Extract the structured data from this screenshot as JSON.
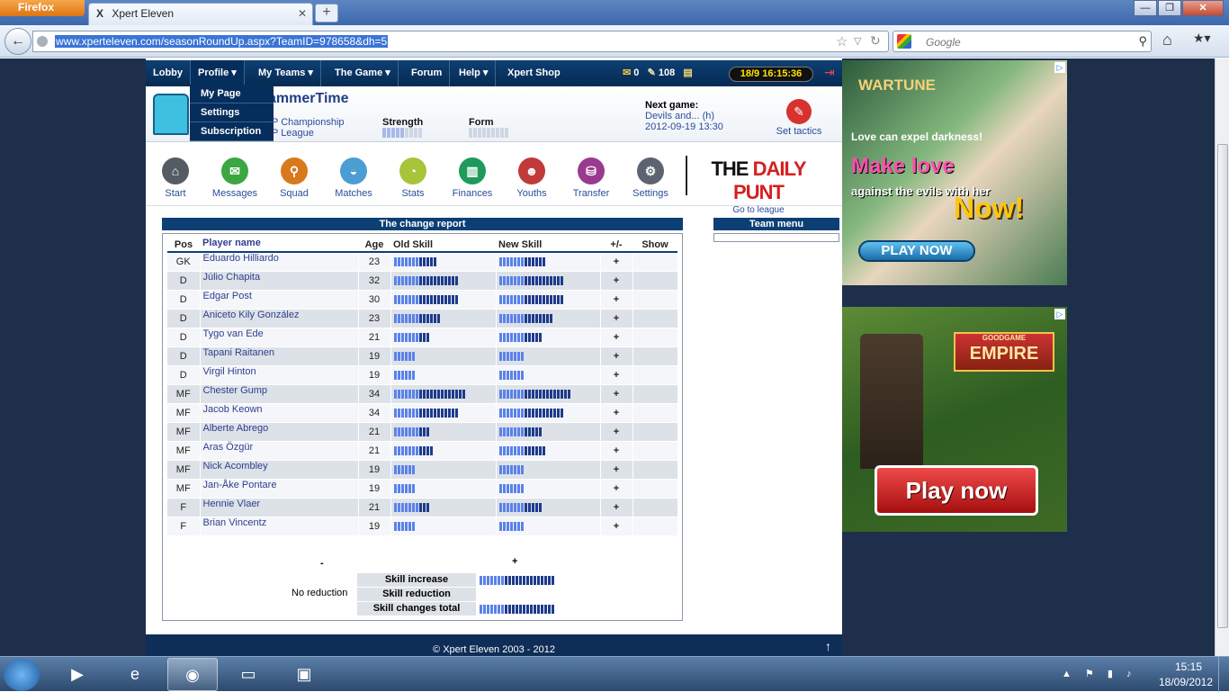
{
  "browser": {
    "menu_button": "Firefox",
    "tab_title": "Xpert Eleven",
    "tab_favicon": "X",
    "url": "www.xperteleven.com/seasonRoundUp.aspx?TeamID=978658&dh=5",
    "search_placeholder": "Google",
    "window_buttons": {
      "minimize": "—",
      "maximize": "❐",
      "close": "✕"
    }
  },
  "site_nav": {
    "items": [
      "Lobby",
      "Profile ▾",
      "My Teams ▾",
      "The Game ▾",
      "Forum",
      "Help ▾",
      "Xpert Shop"
    ],
    "messages_count": "0",
    "credits": "108",
    "clock": "18/9 16:15:36"
  },
  "profile_dropdown": [
    "My Page",
    "Settings",
    "Subscription"
  ],
  "team": {
    "name": "HammerTime",
    "name_visible": "ammerTime",
    "league_1": "P Championship",
    "league_2": "P League",
    "strength_label": "Strength",
    "form_label": "Form",
    "strength_value": 0.55,
    "next_game_label": "Next game:",
    "next_game_opponent": "Devils and... (h)",
    "next_game_time": "2012-09-19 13:30",
    "set_tactics": "Set tactics"
  },
  "icon_menu": [
    {
      "label": "Start",
      "icon": "home-icon",
      "color": "#555b63",
      "glyph": "⌂"
    },
    {
      "label": "Messages",
      "icon": "envelope-icon",
      "color": "#3aa743",
      "glyph": "✉"
    },
    {
      "label": "Squad",
      "icon": "runner-icon",
      "color": "#d8791d",
      "glyph": "⚲"
    },
    {
      "label": "Matches",
      "icon": "pitch-icon",
      "color": "#4b9dd4",
      "glyph": "◒"
    },
    {
      "label": "Stats",
      "icon": "pie-chart-icon",
      "color": "#a7c43a",
      "glyph": "◔"
    },
    {
      "label": "Finances",
      "icon": "bar-chart-icon",
      "color": "#1f9a5a",
      "glyph": "▥"
    },
    {
      "label": "Youths",
      "icon": "people-icon",
      "color": "#c03a3a",
      "glyph": "☻"
    },
    {
      "label": "Transfer",
      "icon": "basket-icon",
      "color": "#9a3a8e",
      "glyph": "⛁"
    },
    {
      "label": "Settings",
      "icon": "gear-icon",
      "color": "#5b6470",
      "glyph": "⚙"
    }
  ],
  "daily_punt": {
    "title_black": "THE ",
    "title_red": "DAILY PUNT",
    "link": "Go to league"
  },
  "report": {
    "title": "The change report",
    "headers": {
      "pos": "Pos",
      "name": "Player name",
      "age": "Age",
      "old": "Old Skill",
      "new": "New Skill",
      "pm": "+/-",
      "show": "Show"
    },
    "players": [
      {
        "pos": "GK",
        "name": "Eduardo Hilliardo",
        "age": "23",
        "old": 12,
        "new": 13,
        "pm": "+"
      },
      {
        "pos": "D",
        "name": "Júlio Chapita",
        "age": "32",
        "old": 18,
        "new": 18,
        "pm": "+"
      },
      {
        "pos": "D",
        "name": "Edgar Post",
        "age": "30",
        "old": 18,
        "new": 18,
        "pm": "+"
      },
      {
        "pos": "D",
        "name": "Aniceto Kily González",
        "age": "23",
        "old": 13,
        "new": 15,
        "pm": "+"
      },
      {
        "pos": "D",
        "name": "Tygo van Ede",
        "age": "21",
        "old": 10,
        "new": 12,
        "pm": "+"
      },
      {
        "pos": "D",
        "name": "Tapani Raitanen",
        "age": "19",
        "old": 6,
        "new": 7,
        "pm": "+"
      },
      {
        "pos": "D",
        "name": "Virgil Hinton",
        "age": "19",
        "old": 6,
        "new": 7,
        "pm": "+"
      },
      {
        "pos": "MF",
        "name": "Chester Gump",
        "age": "34",
        "old": 20,
        "new": 20,
        "pm": "+"
      },
      {
        "pos": "MF",
        "name": "Jacob Keown",
        "age": "34",
        "old": 18,
        "new": 18,
        "pm": "+"
      },
      {
        "pos": "MF",
        "name": "Alberte Abrego",
        "age": "21",
        "old": 10,
        "new": 12,
        "pm": "+"
      },
      {
        "pos": "MF",
        "name": "Aras Özgür",
        "age": "21",
        "old": 11,
        "new": 13,
        "pm": "+"
      },
      {
        "pos": "MF",
        "name": "Nick Acombley",
        "age": "19",
        "old": 6,
        "new": 7,
        "pm": "+"
      },
      {
        "pos": "MF",
        "name": "Jan-Åke Pontare",
        "age": "19",
        "old": 6,
        "new": 7,
        "pm": "+"
      },
      {
        "pos": "F",
        "name": "Hennie Vlaer",
        "age": "21",
        "old": 10,
        "new": 12,
        "pm": "+"
      },
      {
        "pos": "F",
        "name": "Brian Vincentz",
        "age": "19",
        "old": 6,
        "new": 7,
        "pm": "+"
      }
    ],
    "summary": {
      "minus": "-",
      "plus": "+",
      "skill_increase": "Skill increase",
      "skill_reduction": "Skill reduction",
      "skill_total": "Skill changes total",
      "no_reduction": "No reduction",
      "increase_total": 21,
      "changes_total": 21
    }
  },
  "team_menu": {
    "title": "Team menu"
  },
  "footer": {
    "copyright": "© Xpert Eleven 2003 - 2012",
    "top_arrow": "↑"
  },
  "ads": {
    "ad1": {
      "logo": "WARTUNE",
      "line1": "Love can expel darkness!",
      "line2": "Make love",
      "line3": "against the evils with her",
      "line4": "Now!",
      "button": "PLAY NOW"
    },
    "ad2": {
      "brand_small": "GOODGAME",
      "brand": "EMPIRE",
      "button": "Play now"
    }
  },
  "taskbar": {
    "time": "15:15",
    "date": "18/09/2012"
  }
}
